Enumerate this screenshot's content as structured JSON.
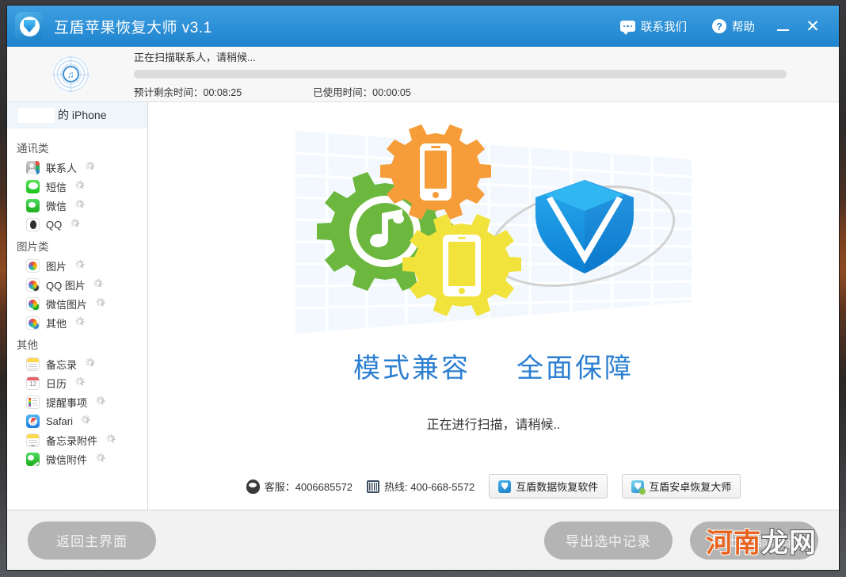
{
  "window": {
    "app_title": "互盾苹果恢复大师 v3.1",
    "logo_icon": "shield-logo-icon",
    "actions": [
      {
        "key": "contact",
        "label": "联系我们",
        "icon": "chat-bubble-icon"
      },
      {
        "key": "help",
        "label": "帮助",
        "icon": "question-mark-circle-icon"
      }
    ],
    "minimize_icon": "minimize-icon",
    "close_icon": "close-icon",
    "close_glyph": "✕"
  },
  "scan": {
    "icon": "music-radar-scan-icon",
    "status_text": "正在扫描联系人，请稍候...",
    "progress_percent": 0,
    "remaining_label": "预计剩余时间：00:08:25",
    "elapsed_label": "已使用时间：00:00:05"
  },
  "sidebar": {
    "device": {
      "redacted": "",
      "name": "的 iPhone"
    },
    "groups": [
      {
        "title": "通讯类",
        "items": [
          {
            "label": "联系人",
            "icon": "contacts-icon",
            "icon_class": "ic-contacts",
            "status": "loading"
          },
          {
            "label": "短信",
            "icon": "messages-icon",
            "icon_class": "ic-sms",
            "status": "loading"
          },
          {
            "label": "微信",
            "icon": "wechat-icon",
            "icon_class": "ic-wechat",
            "status": "loading"
          },
          {
            "label": "QQ",
            "icon": "qq-icon",
            "icon_class": "ic-qq",
            "status": "loading"
          }
        ]
      },
      {
        "title": "图片类",
        "items": [
          {
            "label": "图片",
            "icon": "photos-icon",
            "icon_class": "ic-pic",
            "status": "loading"
          },
          {
            "label": "QQ 图片",
            "icon": "qq-photos-icon",
            "icon_class": "ic-pic ic-pic-qq",
            "status": "loading"
          },
          {
            "label": "微信图片",
            "icon": "wechat-photos-icon",
            "icon_class": "ic-pic ic-pic-wx",
            "status": "loading"
          },
          {
            "label": "其他",
            "icon": "other-photos-icon",
            "icon_class": "ic-pic ic-pic-ot",
            "status": "loading"
          }
        ]
      },
      {
        "title": "其他",
        "items": [
          {
            "label": "备忘录",
            "icon": "notes-icon",
            "icon_class": "ic-notes",
            "status": "loading"
          },
          {
            "label": "日历",
            "icon": "calendar-icon",
            "icon_class": "ic-cal",
            "status": "loading",
            "glyph": "12"
          },
          {
            "label": "提醒事项",
            "icon": "reminders-icon",
            "icon_class": "ic-remind",
            "status": "loading"
          },
          {
            "label": "Safari",
            "icon": "safari-icon",
            "icon_class": "ic-safari",
            "status": "loading"
          },
          {
            "label": "备忘录附件",
            "icon": "notes-attachment-icon",
            "icon_class": "ic-notes ic-notes-att",
            "status": "loading"
          },
          {
            "label": "微信附件",
            "icon": "wechat-attachment-icon",
            "icon_class": "ic-wechat-att",
            "status": "loading"
          }
        ]
      }
    ]
  },
  "main": {
    "illustration": "gears-phone-tablet-shield-illustration",
    "taglines": [
      "模式兼容",
      "全面保障"
    ],
    "scanning_message": "正在进行扫描，请稍候..",
    "support": {
      "qq_icon": "qq-penguin-icon",
      "qq_label": "客服：4006685572",
      "hotline_icon": "telephone-icon",
      "hotline_label": "热线: 400-668-5572",
      "promos": [
        {
          "label": "互盾数据恢复软件",
          "icon": "shield-badge-icon"
        },
        {
          "label": "互盾安卓恢复大师",
          "icon": "shield-android-badge-icon"
        }
      ]
    }
  },
  "footer": {
    "back_button": "返回主界面",
    "export_selected_button": "导出选中记录",
    "export_all_button": "导出全部记录"
  },
  "watermark": {
    "part1": "河南",
    "part2": "龙网"
  },
  "colors": {
    "titlebar_blue": "#1f84ce",
    "accent_blue": "#2c7fd0",
    "button_gray": "#b4b4b4",
    "progress_track": "#dcdcdc",
    "watermark_orange": "#e8641e"
  }
}
